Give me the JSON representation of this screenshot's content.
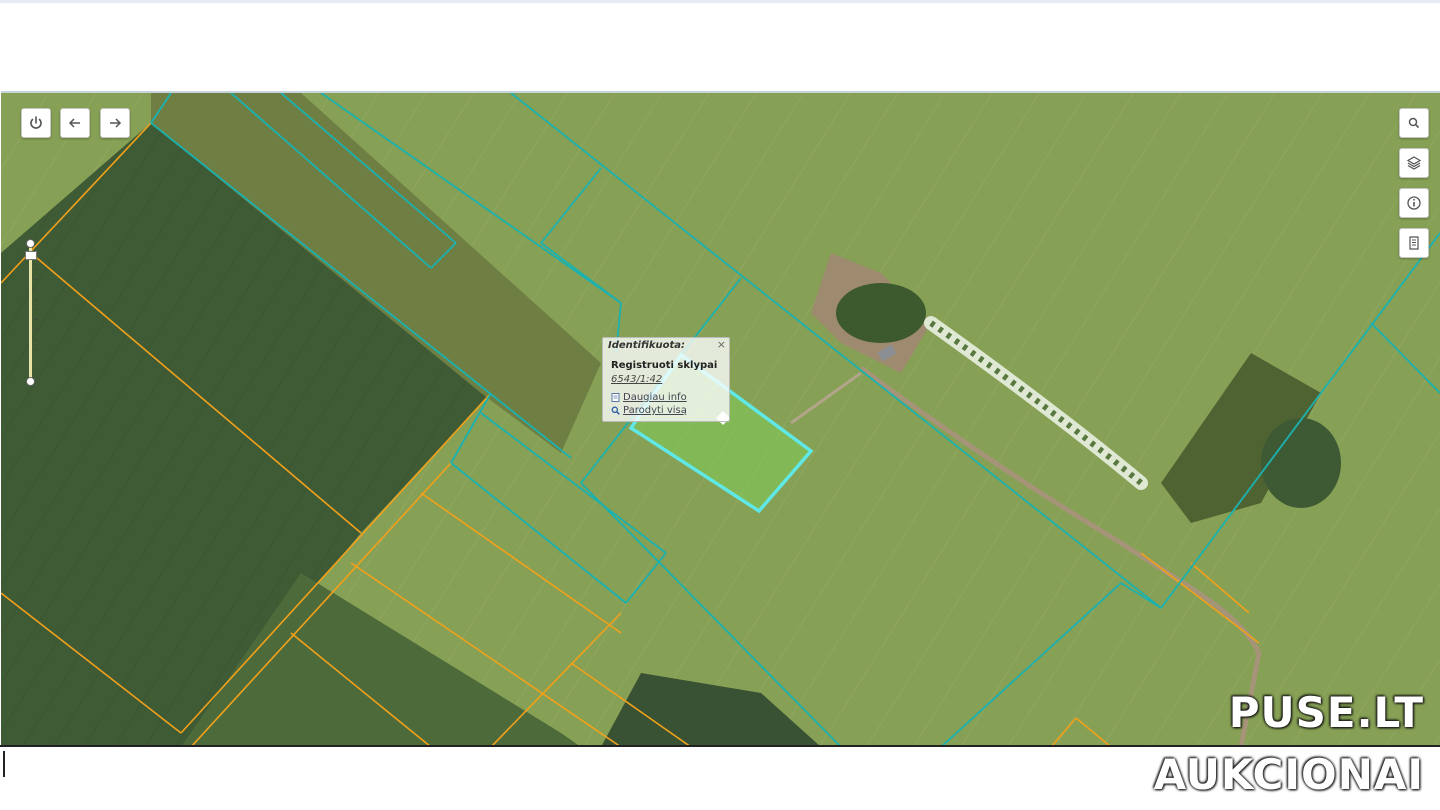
{
  "map": {
    "popup": {
      "header": "Identifikuota:",
      "close_glyph": "×",
      "layer_name": "Registruoti sklypai",
      "parcel_id": "6543/1:42",
      "more_info_label": "Daugiau info",
      "show_all_label": "Parodyti visą"
    },
    "controls": {
      "power_icon": "power-icon",
      "back_icon": "arrow-left-icon",
      "forward_icon": "arrow-right-icon",
      "search_icon": "search-icon",
      "layers_icon": "layers-icon",
      "info_icon": "info-icon",
      "legend_icon": "document-icon"
    },
    "colors": {
      "registered_parcel_line": "#19b2b0",
      "cadastral_line": "#f2a11a",
      "selected_parcel": "#5fe8e6"
    }
  },
  "watermark": {
    "line1": "PUSE.LT",
    "line2": "AUKCIONAI"
  }
}
